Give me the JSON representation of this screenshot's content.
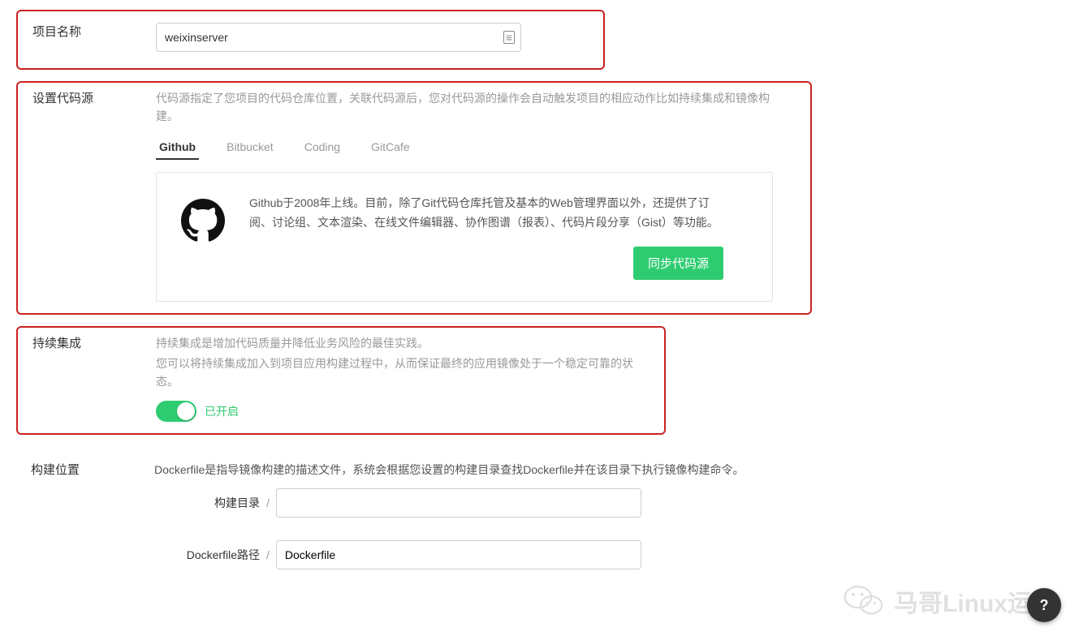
{
  "project_name": {
    "label": "项目名称",
    "value": "weixinserver"
  },
  "code_source": {
    "label": "设置代码源",
    "description": "代码源指定了您项目的代码仓库位置，关联代码源后，您对代码源的操作会自动触发项目的相应动作比如持续集成和镜像构建。",
    "tabs": {
      "github": "Github",
      "bitbucket": "Bitbucket",
      "coding": "Coding",
      "gitcafe": "GitCafe"
    },
    "provider_text": "Github于2008年上线。目前，除了Git代码仓库托管及基本的Web管理界面以外，还提供了订阅、讨论组、文本渲染、在线文件编辑器、协作图谱（报表）、代码片段分享（Gist）等功能。",
    "sync_button": "同步代码源"
  },
  "ci": {
    "label": "持续集成",
    "desc_line1": "持续集成是增加代码质量并降低业务风险的最佳实践。",
    "desc_line2": "您可以将持续集成加入到项目应用构建过程中，从而保证最终的应用镜像处于一个稳定可靠的状态。",
    "toggle_state": "已开启"
  },
  "build": {
    "label": "构建位置",
    "description": "Dockerfile是指导镜像构建的描述文件，系统会根据您设置的构建目录查找Dockerfile并在该目录下执行镜像构建命令。",
    "dir_label": "构建目录",
    "dir_value": "",
    "dockerfile_label": "Dockerfile路径",
    "dockerfile_value": "Dockerfile"
  },
  "watermark": "马哥Linux运维",
  "help_icon": "?"
}
